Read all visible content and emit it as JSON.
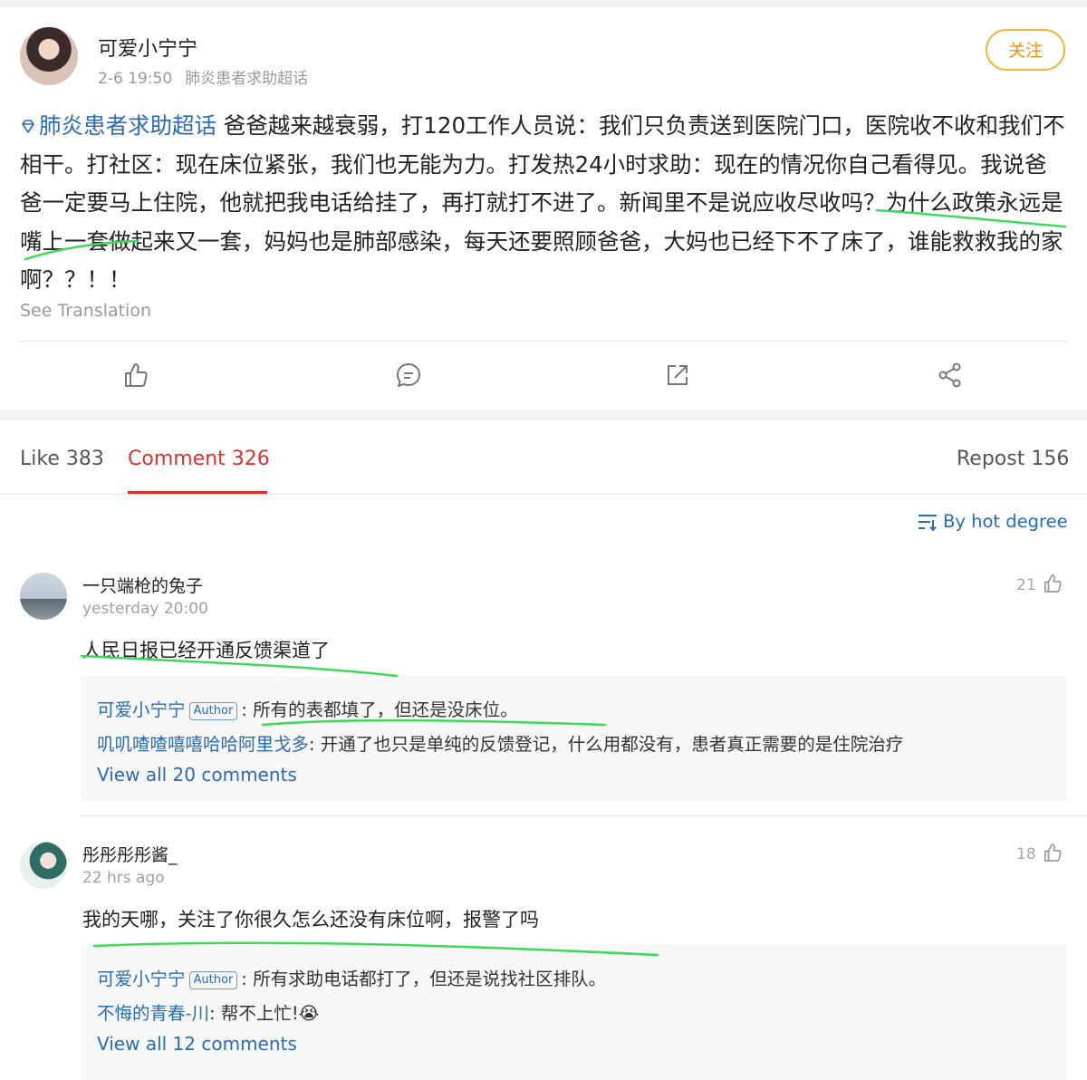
{
  "post": {
    "username": "可爱小宁宁",
    "time": "2-6 19:50",
    "source": "肺炎患者求助超话",
    "follow_label": "关注",
    "topic_link": "肺炎患者求助超话",
    "body": " 爸爸越来越衰弱，打120工作人员说：我们只负责送到医院门口，医院收不收和我们不相干。打社区：现在床位紧张，我们也无能为力。打发热24小时求助：现在的情况你自己看得见。我说爸爸一定要马上住院，他就把我电话给挂了，再打就打不进了。新闻里不是说应收尽收吗？为什么政策永远是嘴上一套做起来又一套，妈妈也是肺部感染，每天还要照顾爸爸，大妈也已经下不了床了，谁能救救我的家啊？？！！",
    "see_translation": "See Translation",
    "actions": [
      {
        "icon": "thumbs-up-icon"
      },
      {
        "icon": "comment-icon"
      },
      {
        "icon": "repost-icon"
      },
      {
        "icon": "share-icon"
      }
    ]
  },
  "tabs": {
    "like": "Like 383",
    "comment": "Comment 326",
    "repost": "Repost 156"
  },
  "sort": {
    "label": "By hot degree",
    "icon": "sort-icon"
  },
  "comments": [
    {
      "username": "一只端枪的兔子",
      "time": "yesterday 20:00",
      "text": "人民日报已经开通反馈渠道了",
      "likes": "21",
      "replies": [
        {
          "name": "可爱小宁宁",
          "badge": "Author",
          "text": ": 所有的表都填了，但还是没床位。"
        },
        {
          "name": "叽叽喳喳嘻嘻哈哈阿里戈多",
          "badge": "",
          "text": ": 开通了也只是单纯的反馈登记，什么用都没有，患者真正需要的是住院治疗"
        }
      ],
      "view_all": "View all 20 comments"
    },
    {
      "username": "彤彤彤彤酱_",
      "time": "22 hrs ago",
      "text": "我的天哪，关注了你很久怎么还没有床位啊，报警了吗",
      "likes": "18",
      "replies": [
        {
          "name": "可爱小宁宁",
          "badge": "Author",
          "text": ": 所有求助电话都打了，但还是说找社区排队。"
        },
        {
          "name": "不悔的青春-川",
          "badge": "",
          "text": ": 帮不上忙!😭"
        }
      ],
      "view_all": "View all 12 comments"
    }
  ],
  "colors": {
    "link": "#2a6cb1",
    "active_tab": "#d8332c",
    "follow": "#f08f1a",
    "highlight": "#3fd85a"
  }
}
